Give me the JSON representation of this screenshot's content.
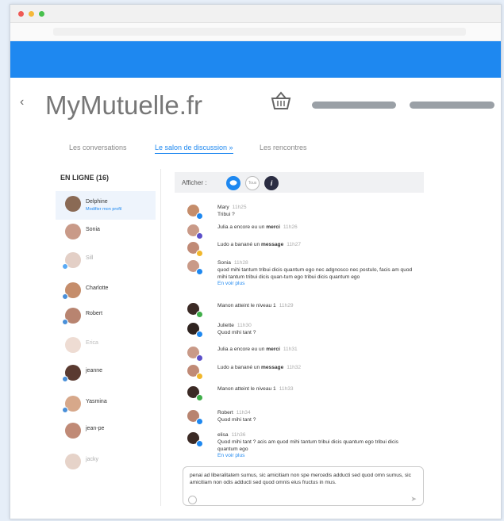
{
  "brand": {
    "logo_text": "MyMutuelle.fr",
    "chevron": "‹"
  },
  "tabs": [
    {
      "label": "Les conversations"
    },
    {
      "label": "Le salon de discussion »"
    },
    {
      "label": "Les rencontres"
    }
  ],
  "online": {
    "title": "EN LIGNE (16)",
    "users": [
      {
        "name": "Delphine",
        "status": "Modifier mon profil"
      },
      {
        "name": "Sonia"
      },
      {
        "name": "Sill"
      },
      {
        "name": "Charlotte"
      },
      {
        "name": "Robert"
      },
      {
        "name": "Erica"
      },
      {
        "name": "jeanne"
      },
      {
        "name": "Yasmina"
      },
      {
        "name": "jean-pe"
      },
      {
        "name": "jacky"
      }
    ]
  },
  "filter": {
    "label": "Afficher :",
    "btn2": "Tous",
    "btn3": "i"
  },
  "messages": [
    {
      "author": "Mary",
      "time": "11h25",
      "text": "Tribui ?"
    },
    {
      "pre": "Julia a encore eu un ",
      "bold": "merci",
      "time": "11h26"
    },
    {
      "pre": "Ludo a banané un ",
      "bold": "message",
      "time": "11h27"
    },
    {
      "author": "Sonia",
      "time": "11h28",
      "text": "quod mihi tantum tribui dicis quantum ego nec adgnosco nec postulo, facis am quod mihi tantum tribui dicis quan-tum ego tribui dicis quantum ego",
      "link": "En voir plus"
    },
    {
      "pre": "Manon atteint le niveau 1",
      "time": "11h29"
    },
    {
      "author": "Juliette",
      "time": "11h30",
      "text": "Quod mihi tant ?"
    },
    {
      "pre": "Julia a encore eu un ",
      "bold": "merci",
      "time": "11h31"
    },
    {
      "pre": "Ludo a banané un ",
      "bold": "message",
      "time": "11h32"
    },
    {
      "pre": "Manon atteint le niveau 1",
      "time": "11h33"
    },
    {
      "author": "Robert",
      "time": "11h34",
      "text": "Quod mihi tant ?"
    },
    {
      "author": "elisa",
      "time": "11h36",
      "text": "Quod mihi tant ? acis am quod mihi tantum tribui dicis quantum ego tribui dicis quantum ego",
      "link": "En voir plus"
    }
  ],
  "composer": {
    "text": "penai ad liberalitatem sumus, sic amicitiam non spe mercedis adducti sed quod omn sumus, sic amicitiam non odis adducti sed quod omnis eius fructus in mus."
  },
  "colors": {
    "accent": "#1e88f0",
    "header_bar": "#1e88f0"
  }
}
